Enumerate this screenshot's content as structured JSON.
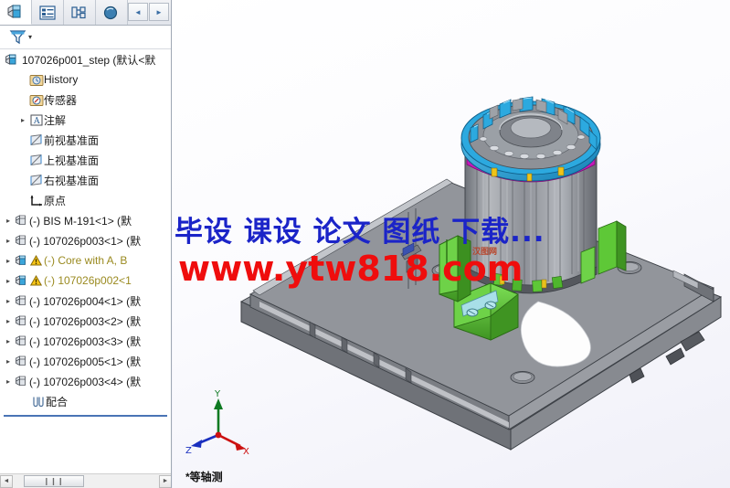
{
  "panel": {
    "tabs": [
      {
        "name": "feature-manager-tab",
        "icon": "cube-icon",
        "active": true
      },
      {
        "name": "property-manager-tab",
        "icon": "list-panel-icon",
        "active": false
      },
      {
        "name": "configuration-manager-tab",
        "icon": "config-tree-icon",
        "active": false
      },
      {
        "name": "display-manager-tab",
        "icon": "appearance-sphere-icon",
        "active": false
      }
    ],
    "nav": {
      "prev_label": "◄",
      "next_label": "►"
    },
    "filter": {
      "name": "filter-icon",
      "dropdown_label": "▾"
    },
    "scrollbar": {
      "left_arrow": "◄",
      "right_arrow": "►",
      "thumb_grip": "❙❙❙"
    }
  },
  "tree": {
    "root": {
      "label": "107026p001_step  (默认<默",
      "icon": "assembly-icon"
    },
    "items": [
      {
        "label": "History",
        "icon": "history-folder-icon",
        "expand": false,
        "warn": false,
        "depth": 1
      },
      {
        "label": "传感器",
        "icon": "sensor-folder-icon",
        "expand": false,
        "warn": false,
        "depth": 1
      },
      {
        "label": "注解",
        "icon": "annotations-icon",
        "expand": true,
        "warn": false,
        "depth": 1
      },
      {
        "label": "前视基准面",
        "icon": "plane-icon",
        "expand": false,
        "warn": false,
        "depth": 1
      },
      {
        "label": "上视基准面",
        "icon": "plane-icon",
        "expand": false,
        "warn": false,
        "depth": 1
      },
      {
        "label": "右视基准面",
        "icon": "plane-icon",
        "expand": false,
        "warn": false,
        "depth": 1
      },
      {
        "label": "原点",
        "icon": "origin-icon",
        "expand": false,
        "warn": false,
        "depth": 1
      },
      {
        "label": "(-) BIS M-191<1> (默",
        "icon": "part-icon",
        "expand": true,
        "warn": false,
        "depth": 0
      },
      {
        "label": "(-) 107026p003<1> (默",
        "icon": "part-icon",
        "expand": true,
        "warn": false,
        "depth": 0
      },
      {
        "label": "(-) Core with A, B",
        "icon": "subassembly-icon",
        "expand": true,
        "warn": true,
        "depth": 0
      },
      {
        "label": "(-) 107026p002<1",
        "icon": "subassembly-icon",
        "expand": true,
        "warn": true,
        "depth": 0
      },
      {
        "label": "(-) 107026p004<1> (默",
        "icon": "part-icon",
        "expand": true,
        "warn": false,
        "depth": 0
      },
      {
        "label": "(-) 107026p003<2> (默",
        "icon": "part-icon",
        "expand": true,
        "warn": false,
        "depth": 0
      },
      {
        "label": "(-) 107026p003<3> (默",
        "icon": "part-icon",
        "expand": true,
        "warn": false,
        "depth": 0
      },
      {
        "label": "(-) 107026p005<1> (默",
        "icon": "part-icon",
        "expand": true,
        "warn": false,
        "depth": 0
      },
      {
        "label": "(-) 107026p003<4> (默",
        "icon": "part-icon",
        "expand": true,
        "warn": false,
        "depth": 0
      }
    ],
    "mates": {
      "label": "配合",
      "icon": "mates-paperclip-icon"
    }
  },
  "viewport": {
    "view_label": "*等轴测",
    "triad": {
      "x_label": "X",
      "y_label": "Y",
      "z_label": "Z",
      "x_color": "#cc1111",
      "y_color": "#0f7a22",
      "z_color": "#1a2fbf"
    }
  },
  "watermark": {
    "line1": "毕设  课设  论文  图纸  下载...",
    "line2": "www.ytw818.com",
    "small": "汉图网",
    "color1": "#1b24c8",
    "color2": "#ef0d0d"
  },
  "model": {
    "colors": {
      "steel": "#8d9096",
      "steel_dark": "#6c6f76",
      "steel_light": "#b9bcc2",
      "cyan": "#24a7e0",
      "cyan_dark": "#1378a8",
      "magenta": "#d417c7",
      "green": "#5ec837",
      "green_dark": "#3f9422",
      "teal": "#9fdbe6"
    }
  }
}
